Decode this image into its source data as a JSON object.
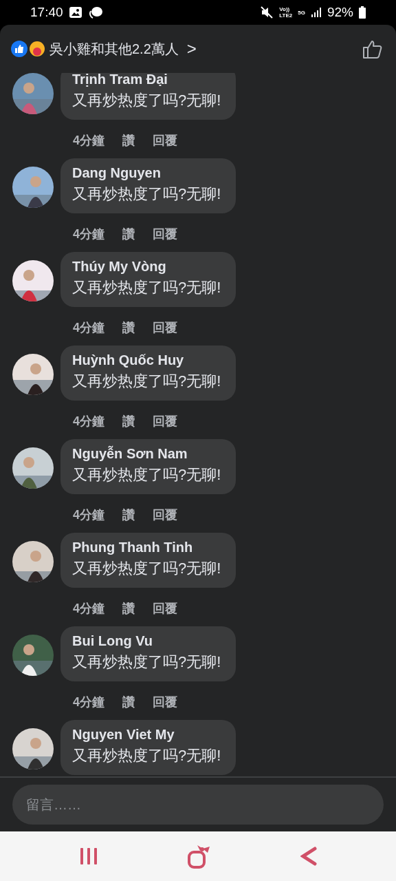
{
  "status_bar": {
    "time": "17:40",
    "volte_top": "Vo))",
    "volte_bottom": "LTE2",
    "network": "5G",
    "battery": "92%"
  },
  "header": {
    "reactions": "吳小雞和其他2.2萬人",
    "arrow": ">"
  },
  "comments": [
    {
      "name": "Trịnh Tram Đại",
      "text": "又再炒热度了吗?无聊!",
      "time": "4分鐘",
      "like": "讚",
      "reply": "回覆"
    },
    {
      "name": "Dang Nguyen",
      "text": "又再炒热度了吗?无聊!",
      "time": "4分鐘",
      "like": "讚",
      "reply": "回覆"
    },
    {
      "name": "Thúy My Vòng",
      "text": "又再炒热度了吗?无聊!",
      "time": "4分鐘",
      "like": "讚",
      "reply": "回覆"
    },
    {
      "name": "Huỳnh Quốc Huy",
      "text": "又再炒热度了吗?无聊!",
      "time": "4分鐘",
      "like": "讚",
      "reply": "回覆"
    },
    {
      "name": "Nguyễn Sơn Nam",
      "text": "又再炒热度了吗?无聊!",
      "time": "4分鐘",
      "like": "讚",
      "reply": "回覆"
    },
    {
      "name": "Phung Thanh Tinh",
      "text": "又再炒热度了吗?无聊!",
      "time": "4分鐘",
      "like": "讚",
      "reply": "回覆"
    },
    {
      "name": "Bui Long Vu",
      "text": "又再炒热度了吗?无聊!",
      "time": "4分鐘",
      "like": "讚",
      "reply": "回覆"
    },
    {
      "name": "Nguyen Viet My",
      "text": "又再炒热度了吗?无聊!"
    }
  ],
  "composer": {
    "placeholder": "留言……"
  }
}
